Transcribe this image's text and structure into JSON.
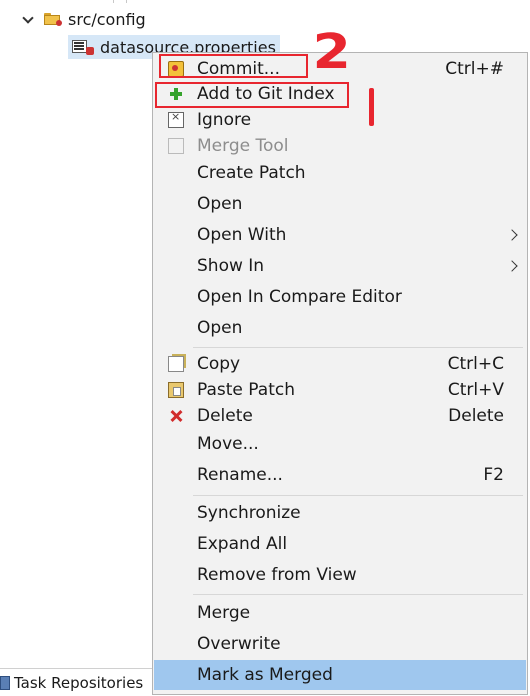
{
  "tree": {
    "folder_label": "src/config",
    "file_label": "datasource.properties"
  },
  "bottom_tab": {
    "label": "Task Repositories"
  },
  "menu": {
    "items": [
      {
        "label": "Commit...",
        "accel": "Ctrl+#",
        "icon": "commit-icon"
      },
      {
        "label": "Add to Git Index",
        "accel": "",
        "icon": "add-icon"
      },
      {
        "label": "Ignore",
        "accel": "",
        "icon": "ignore-icon"
      },
      {
        "label": "Merge Tool",
        "accel": "",
        "icon": "merge-tool-icon",
        "disabled": true
      },
      {
        "label": "Create Patch",
        "accel": ""
      },
      {
        "label": "Open",
        "accel": ""
      },
      {
        "label": "Open With",
        "accel": "",
        "submenu": true
      },
      {
        "label": "Show In",
        "accel": "",
        "submenu": true
      },
      {
        "label": "Open In Compare Editor",
        "accel": ""
      },
      {
        "label": "Open",
        "accel": ""
      },
      {
        "label": "Copy",
        "accel": "Ctrl+C",
        "icon": "copy-icon"
      },
      {
        "label": "Paste Patch",
        "accel": "Ctrl+V",
        "icon": "paste-icon"
      },
      {
        "label": "Delete",
        "accel": "Delete",
        "icon": "delete-icon"
      },
      {
        "label": "Move...",
        "accel": ""
      },
      {
        "label": "Rename...",
        "accel": "F2"
      },
      {
        "label": "Synchronize",
        "accel": ""
      },
      {
        "label": "Expand All",
        "accel": ""
      },
      {
        "label": "Remove from View",
        "accel": ""
      },
      {
        "label": "Merge",
        "accel": ""
      },
      {
        "label": "Overwrite",
        "accel": ""
      },
      {
        "label": "Mark as Merged",
        "accel": "",
        "highlighted": true
      }
    ]
  },
  "annotations": {
    "number_two": "2",
    "number_one": "1",
    "color": "#e8262f"
  }
}
